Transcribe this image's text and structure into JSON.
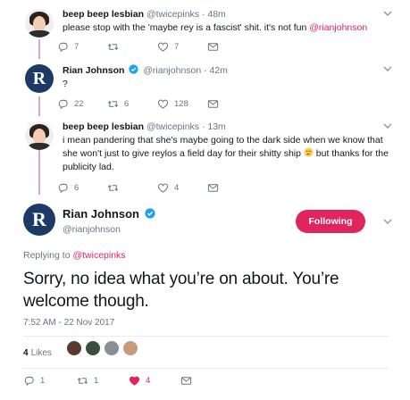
{
  "colors": {
    "accent": "#e0245e",
    "muted": "#657786",
    "thread": "#e1a8b5",
    "verified": "#1da1f2"
  },
  "tweet1": {
    "name": "beep beep lesbian",
    "handle": "@twicepinks",
    "time": "· 48m",
    "text_before": "please stop with the 'maybe rey is a fascist' shit. it's not fun ",
    "text_mention": "@rianjohnson",
    "reply_count": "7",
    "retweet_count": "",
    "like_count": "7"
  },
  "tweet2": {
    "name": "Rian Johnson",
    "handle": "@rianjohnson",
    "time": "· 42m",
    "avatar_letter": "R",
    "text": "?",
    "reply_count": "22",
    "retweet_count": "6",
    "like_count": "128"
  },
  "tweet3": {
    "name": "beep beep lesbian",
    "handle": "@twicepinks",
    "time": "· 13m",
    "line1": "i mean pandering that she's maybe going to the dark side when we know that",
    "line2a": "she won't just to give reylos a field day for their shitty ship ",
    "line2b": " but thanks for the",
    "line3": "publicity lad.",
    "reply_count": "6",
    "retweet_count": "",
    "like_count": "4"
  },
  "main": {
    "name": "Rian Johnson",
    "handle": "@rianjohnson",
    "avatar_letter": "R",
    "follow_label": "Following",
    "replying_prefix": "Replying to ",
    "replying_handle": "@twicepinks",
    "text": "Sorry, no idea what you’re on about. You’re welcome though.",
    "timestamp": "7:52 AM - 22 Nov 2017",
    "likes_count": "4",
    "likes_label": "Likes",
    "reply_count": "1",
    "retweet_count": "1",
    "like_count": "4"
  },
  "icons": [
    "reply-icon",
    "retweet-icon",
    "like-icon",
    "dm-icon",
    "verified-icon",
    "chevron-down-icon",
    "thinking-face-icon"
  ]
}
